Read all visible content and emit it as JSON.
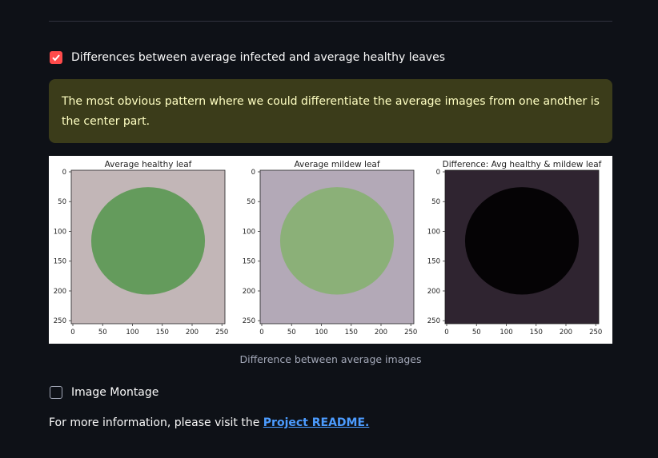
{
  "section": {
    "checkbox1": {
      "label": "Differences between average infected and average healthy leaves",
      "checked": true
    },
    "info_text": "The most obvious pattern where we could differentiate the average images from one another is the center part.",
    "figure": {
      "panels": [
        {
          "title": "Average healthy leaf",
          "bg": "#c2b6b7",
          "leaf": "#5f9a56",
          "leaf_opacity": 0.95
        },
        {
          "title": "Average mildew leaf",
          "bg": "#b3a9b7",
          "leaf": "#86b071",
          "leaf_opacity": 0.9
        },
        {
          "title": "Difference: Avg healthy & mildew leaf",
          "bg": "#2f2430",
          "leaf": "#050305",
          "leaf_opacity": 1.0
        }
      ],
      "x_ticks": [
        "0",
        "50",
        "100",
        "150",
        "200",
        "250"
      ],
      "y_ticks": [
        "0",
        "50",
        "100",
        "150",
        "200",
        "250"
      ]
    },
    "caption": "Difference between average images",
    "checkbox2": {
      "label": "Image Montage",
      "checked": false
    }
  },
  "footer": {
    "text": "For more information, please visit the ",
    "link_text": "Project README."
  },
  "colors": {
    "background": "#0e1117",
    "accent": "#ff4b4b",
    "link": "#4c9cff",
    "info_bg": "#3b3c1a",
    "info_text": "#ffffc2"
  }
}
